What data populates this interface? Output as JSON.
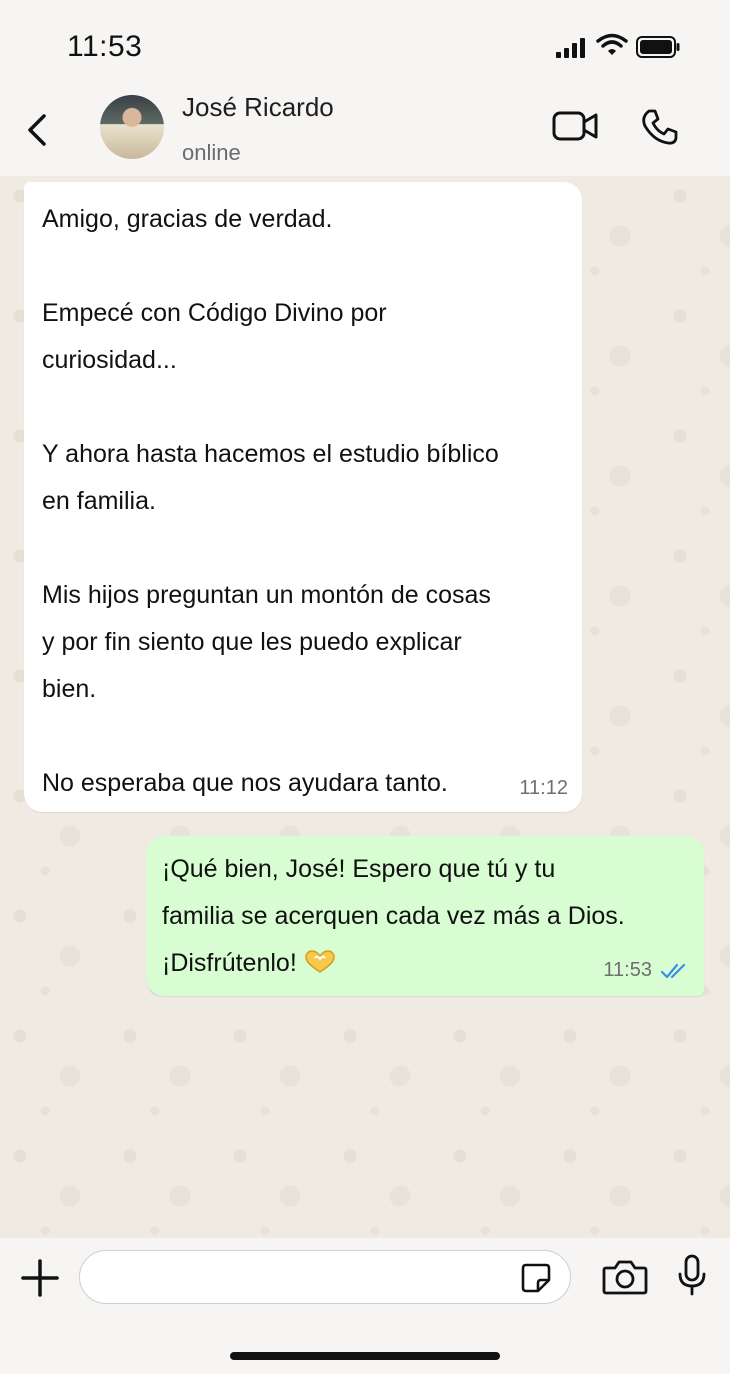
{
  "status_bar": {
    "time": "11:53",
    "icons": [
      "signal-icon",
      "wifi-icon",
      "battery-icon"
    ]
  },
  "header": {
    "contact_name": "José Ricardo",
    "contact_status": "online",
    "icons": [
      "back-chevron-icon",
      "video-call-icon",
      "phone-call-icon"
    ]
  },
  "messages": [
    {
      "direction": "incoming",
      "text": "Amigo, gracias de verdad.\n\nEmpecé con Código Divino por\ncuriosidad...\n\nY ahora hasta hacemos el estudio bíblico\nen familia.\n\nMis hijos preguntan un montón de cosas\ny por fin siento que les puedo explicar\nbien.\n\nNo esperaba que nos ayudara tanto.",
      "time": "11:12"
    },
    {
      "direction": "outgoing",
      "text": "¡Qué bien, José! Espero que tú y tu\nfamilia se acerquen cada vez más a Dios.\n¡Disfrútenlo!",
      "emoji": "heart-hands-icon",
      "time": "11:53",
      "read_status": "read-double-check-icon"
    }
  ],
  "composer": {
    "input_value": "",
    "icons": [
      "plus-icon",
      "sticker-icon",
      "camera-icon",
      "microphone-icon"
    ]
  },
  "colors": {
    "outgoing_bubble": "#d8fdd2",
    "incoming_bubble": "#ffffff",
    "read_ticks": "#3a8ee6",
    "wallpaper": "#efeae2"
  }
}
